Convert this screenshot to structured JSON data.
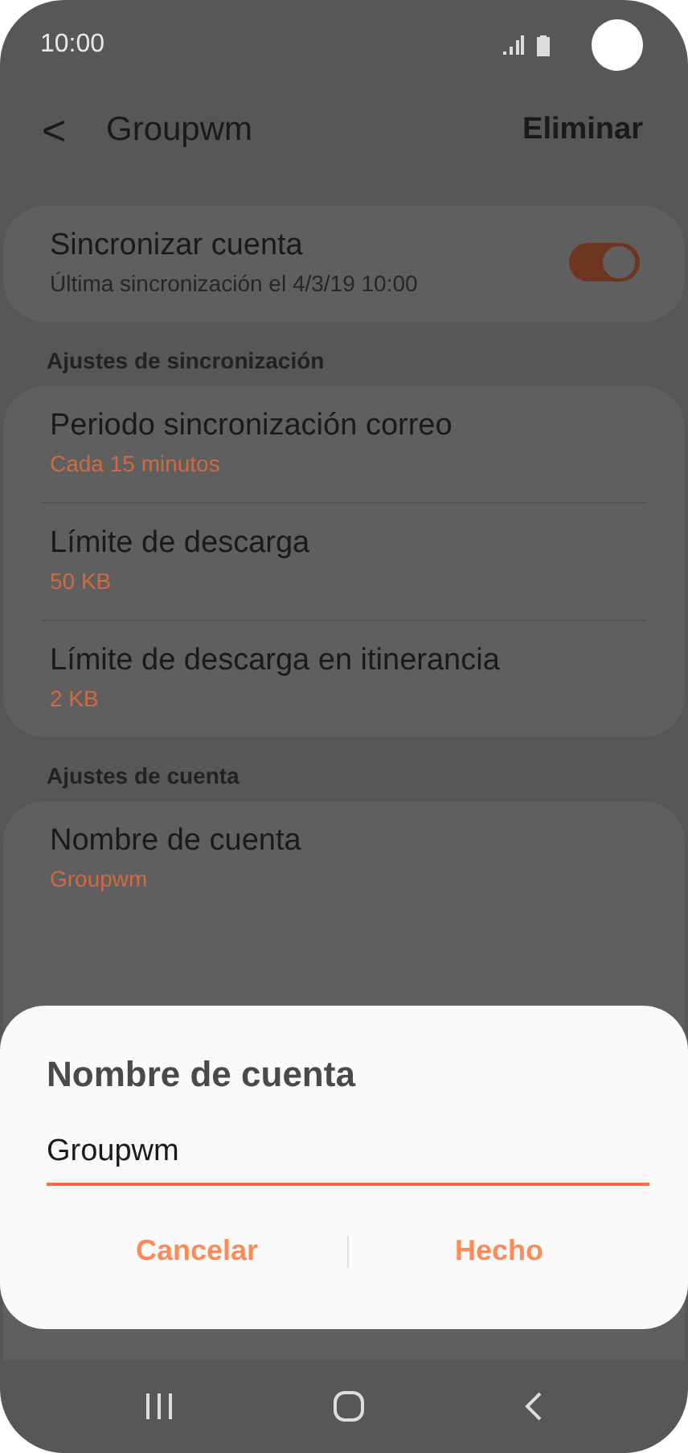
{
  "status_bar": {
    "time": "10:00"
  },
  "header": {
    "back_icon": "<",
    "title": "Groupwm",
    "action": "Eliminar"
  },
  "sections": [
    {
      "rows": [
        {
          "kind": "toggle",
          "title": "Sincronizar cuenta",
          "subtitle": "Última sincronización el 4/3/19  10:00",
          "on": true
        }
      ]
    },
    {
      "label": "Ajustes de sincronización",
      "rows": [
        {
          "kind": "value",
          "title": "Periodo sincronización correo",
          "value": "Cada 15 minutos"
        },
        {
          "kind": "value",
          "title": "Límite de descarga",
          "value": "50 KB"
        },
        {
          "kind": "value",
          "title": "Límite de descarga en itinerancia",
          "value": "2 KB"
        }
      ]
    },
    {
      "label": "Ajustes de cuenta",
      "rows": [
        {
          "kind": "value",
          "title": "Nombre de cuenta",
          "value": "Groupwm"
        }
      ]
    }
  ],
  "dialog": {
    "title": "Nombre de cuenta",
    "value": "Groupwm",
    "buttons": [
      "Cancelar",
      "Hecho"
    ]
  }
}
